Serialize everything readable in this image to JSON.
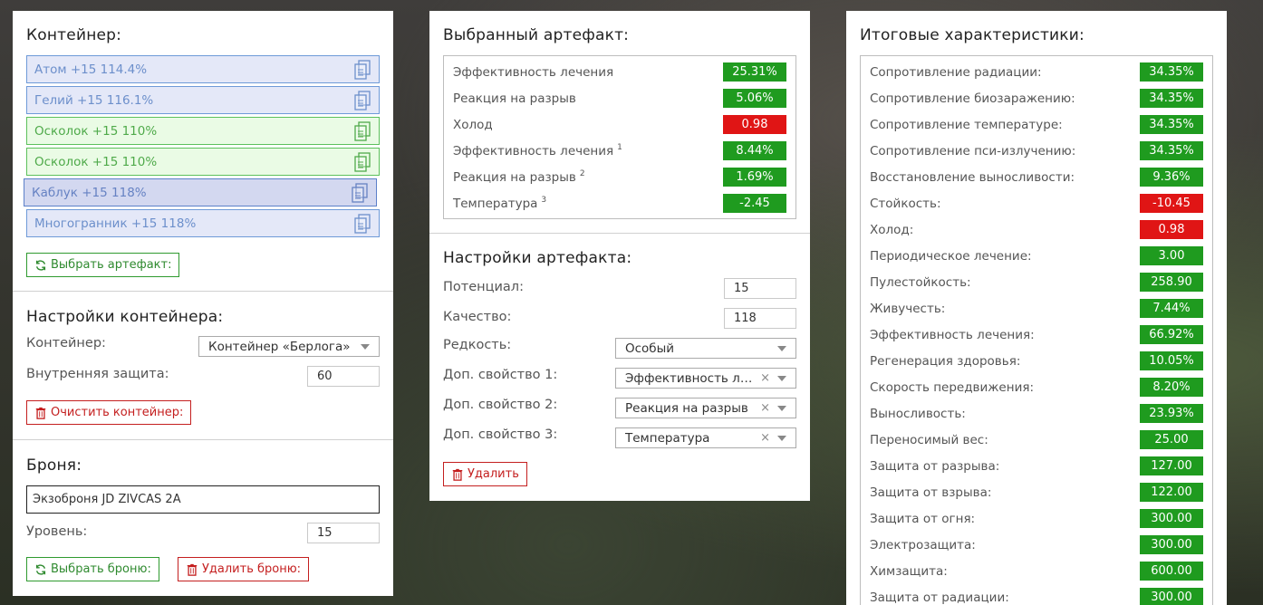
{
  "container_panel": {
    "title": "Контейнер:",
    "slots": [
      {
        "label": "Атом +15 114.4%",
        "style": "blue"
      },
      {
        "label": "Гелий +15 116.1%",
        "style": "blue"
      },
      {
        "label": "Осколок +15 110%",
        "style": "green"
      },
      {
        "label": "Осколок +15 110%",
        "style": "green"
      },
      {
        "label": "Каблук +15 118%",
        "style": "sel"
      },
      {
        "label": "Многогранник +15 118%",
        "style": "blue"
      }
    ],
    "choose_button": "Выбрать артефакт:",
    "settings_title": "Настройки контейнера:",
    "container_label": "Контейнер:",
    "container_value": "Контейнер «Берлога»",
    "inner_protection_label": "Внутренняя защита:",
    "inner_protection_value": "60",
    "clear_button": "Очистить контейнер:",
    "armor_title": "Броня:",
    "armor_value": "Экзоброня JD ZIVCAS 2A",
    "level_label": "Уровень:",
    "level_value": "15",
    "choose_armor_button": "Выбрать броню:",
    "delete_armor_button": "Удалить броню:"
  },
  "artifact_panel": {
    "title": "Выбранный артефакт:",
    "stats": [
      {
        "name": "Эффективность лечения",
        "sup": "",
        "value": "25.31%",
        "tone": "pos"
      },
      {
        "name": "Реакция на разрыв",
        "sup": "",
        "value": "5.06%",
        "tone": "pos"
      },
      {
        "name": "Холод",
        "sup": "",
        "value": "0.98",
        "tone": "neg"
      },
      {
        "name": "Эффективность лечения",
        "sup": "1",
        "value": "8.44%",
        "tone": "pos"
      },
      {
        "name": "Реакция на разрыв",
        "sup": "2",
        "value": "1.69%",
        "tone": "pos"
      },
      {
        "name": "Температура",
        "sup": "3",
        "value": "-2.45",
        "tone": "pos"
      }
    ],
    "settings_title": "Настройки артефакта:",
    "potential_label": "Потенциал:",
    "potential_value": "15",
    "quality_label": "Качество:",
    "quality_value": "118",
    "rarity_label": "Редкость:",
    "rarity_value": "Особый",
    "extra1_label": "Доп. свойство 1:",
    "extra1_value": "Эффективность лечения",
    "extra2_label": "Доп. свойство 2:",
    "extra2_value": "Реакция на разрыв",
    "extra3_label": "Доп. свойство 3:",
    "extra3_value": "Температура",
    "clear_mark": "×",
    "delete_button": "Удалить"
  },
  "totals_panel": {
    "title": "Итоговые характеристики:",
    "stats": [
      {
        "name": "Сопротивление радиации:",
        "value": "34.35%",
        "tone": "pos"
      },
      {
        "name": "Сопротивление биозаражению:",
        "value": "34.35%",
        "tone": "pos"
      },
      {
        "name": "Сопротивление температуре:",
        "value": "34.35%",
        "tone": "pos"
      },
      {
        "name": "Сопротивление пси-излучению:",
        "value": "34.35%",
        "tone": "pos"
      },
      {
        "name": "Восстановление выносливости:",
        "value": "9.36%",
        "tone": "pos"
      },
      {
        "name": "Стойкость:",
        "value": "-10.45",
        "tone": "neg"
      },
      {
        "name": "Холод:",
        "value": "0.98",
        "tone": "neg"
      },
      {
        "name": "Периодическое лечение:",
        "value": "3.00",
        "tone": "pos"
      },
      {
        "name": "Пулестойкость:",
        "value": "258.90",
        "tone": "pos"
      },
      {
        "name": "Живучесть:",
        "value": "7.44%",
        "tone": "pos"
      },
      {
        "name": "Эффективность лечения:",
        "value": "66.92%",
        "tone": "pos"
      },
      {
        "name": "Регенерация здоровья:",
        "value": "10.05%",
        "tone": "pos"
      },
      {
        "name": "Скорость передвижения:",
        "value": "8.20%",
        "tone": "pos"
      },
      {
        "name": "Выносливость:",
        "value": "23.93%",
        "tone": "pos"
      },
      {
        "name": "Переносимый вес:",
        "value": "25.00",
        "tone": "pos"
      },
      {
        "name": "Защита от разрыва:",
        "value": "127.00",
        "tone": "pos"
      },
      {
        "name": "Защита от взрыва:",
        "value": "122.00",
        "tone": "pos"
      },
      {
        "name": "Защита от огня:",
        "value": "300.00",
        "tone": "pos"
      },
      {
        "name": "Электрозащита:",
        "value": "300.00",
        "tone": "pos"
      },
      {
        "name": "Химзащита:",
        "value": "600.00",
        "tone": "pos"
      },
      {
        "name": "Защита от радиации:",
        "value": "300.00",
        "tone": "pos"
      }
    ]
  },
  "colors": {
    "positive": "#1f9b1f",
    "negative": "#e01515",
    "button_green": "#2f9a2f",
    "button_red": "#c41f1f"
  },
  "icons": {
    "slot": "copy-icon",
    "choose": "refresh-icon",
    "delete": "trash-icon",
    "dropdown": "caret-down-icon"
  }
}
